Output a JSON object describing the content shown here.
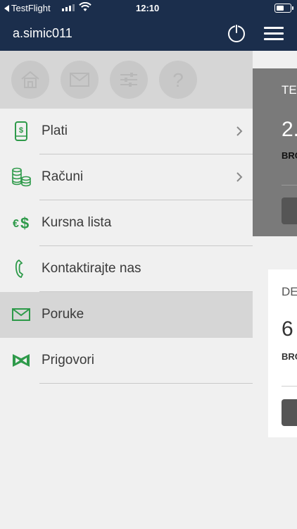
{
  "status_bar": {
    "back_app": "TestFlight",
    "time": "12:10"
  },
  "header": {
    "username": "a.simic011",
    "icons": [
      "power-icon",
      "hamburger-menu-icon"
    ]
  },
  "quick_actions": [
    "home-icon",
    "mail-icon",
    "settings-sliders-icon",
    "help-icon"
  ],
  "menu": {
    "items": [
      {
        "label": "Plati",
        "icon": "phone-dollar-icon",
        "has_chevron": true
      },
      {
        "label": "Računi",
        "icon": "coins-icon",
        "has_chevron": true
      },
      {
        "label": "Kursna lista",
        "icon": "exchange-euro-dollar-icon",
        "has_chevron": false
      },
      {
        "label": "Kontaktirajte nas",
        "icon": "phone-handset-icon",
        "has_chevron": false
      },
      {
        "label": "Poruke",
        "icon": "envelope-icon",
        "has_chevron": false,
        "active": true
      },
      {
        "label": "Prigovori",
        "icon": "complaint-ribbon-icon",
        "has_chevron": false
      }
    ]
  },
  "background_cards": [
    {
      "title_fragment": "TE",
      "value_fragment": "2.",
      "caption_fragment": "BRO"
    },
    {
      "title_fragment": "DE",
      "value_fragment": "6",
      "caption_fragment": "BRO"
    }
  ],
  "colors": {
    "header_bg": "#1b2e4c",
    "accent_green": "#2e9a4a",
    "active_row_bg": "#d6d6d6"
  }
}
